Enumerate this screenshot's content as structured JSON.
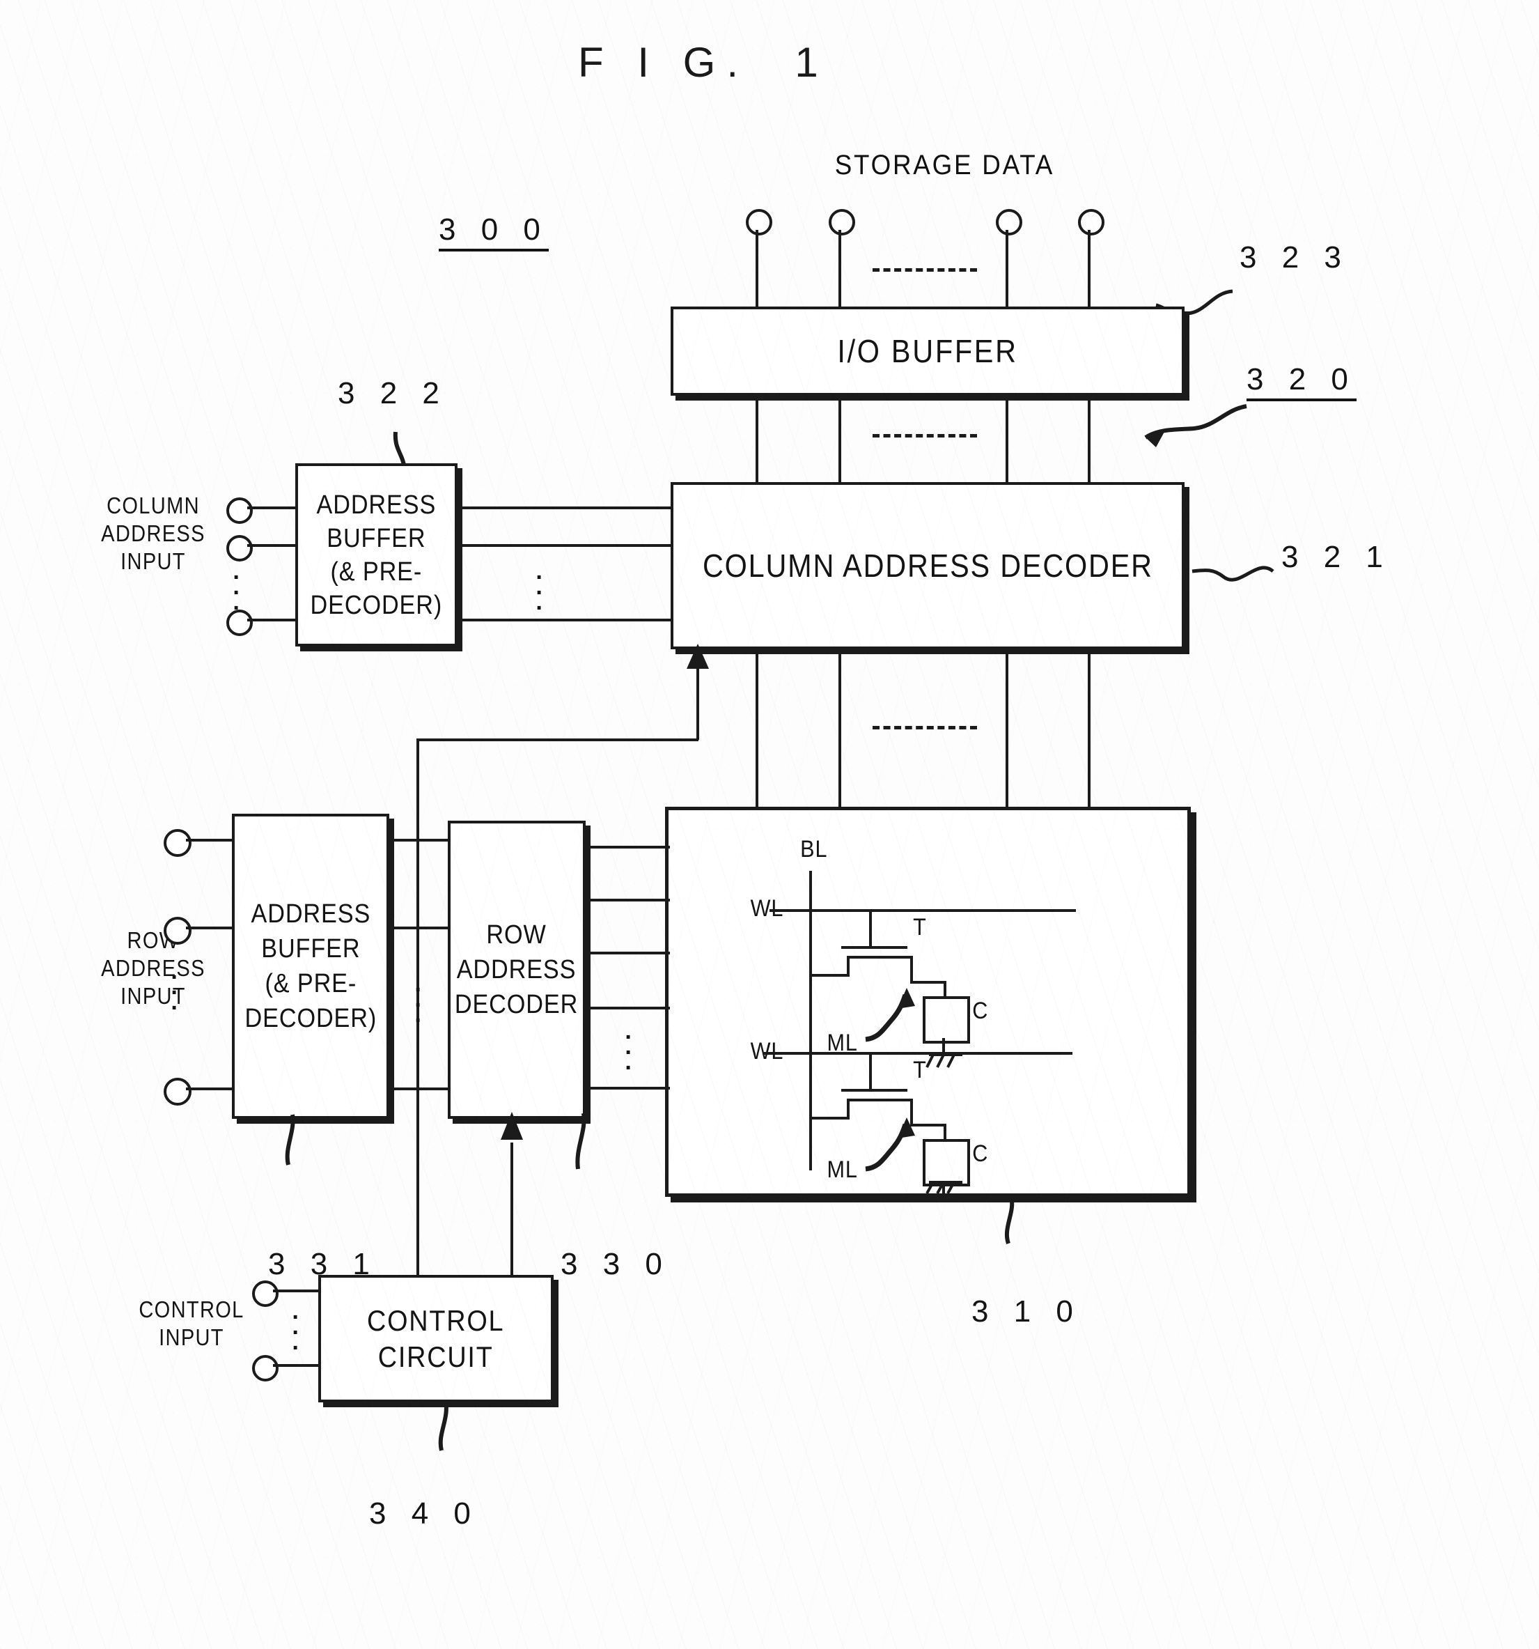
{
  "figure": {
    "title": "F I G.  1",
    "top_label": "STORAGE DATA"
  },
  "references": {
    "device": "3 0 0",
    "address_buffer_column": "3 2 2",
    "io_buffer": "3 2 3",
    "column_system": "3 2 0",
    "column_address_decoder": "3 2 1",
    "address_buffer_row": "3 3 1",
    "row_address_decoder": "3 3 0",
    "memory_array": "3 1 0",
    "control_circuit": "3 4 0"
  },
  "blocks": {
    "io_buffer": "I/O BUFFER",
    "column_address_buffer": "ADDRESS\nBUFFER\n(& PRE-\nDECODER)",
    "column_address_decoder": "COLUMN ADDRESS DECODER",
    "row_address_buffer": "ADDRESS\nBUFFER\n(& PRE-\nDECODER)",
    "row_address_decoder": "ROW\nADDRESS\nDECODER",
    "control_circuit": "CONTROL\nCIRCUIT"
  },
  "input_labels": {
    "column": "COLUMN\nADDRESS\nINPUT",
    "row": "ROW\nADDRESS\nINPUT",
    "control": "CONTROL\nINPUT"
  },
  "cell_labels": {
    "bitline": "BL",
    "wordline_1": "WL",
    "wordline_2": "WL",
    "transistor_1": "T",
    "transistor_2": "T",
    "capacitor_1": "C",
    "capacitor_2": "C",
    "memory_cell_1": "ML",
    "memory_cell_2": "ML"
  },
  "ellipsis": {
    "vertical": "·\n·\n·"
  },
  "colors": {
    "ink": "#1b1b1b",
    "paper": "#fdfdfd"
  }
}
